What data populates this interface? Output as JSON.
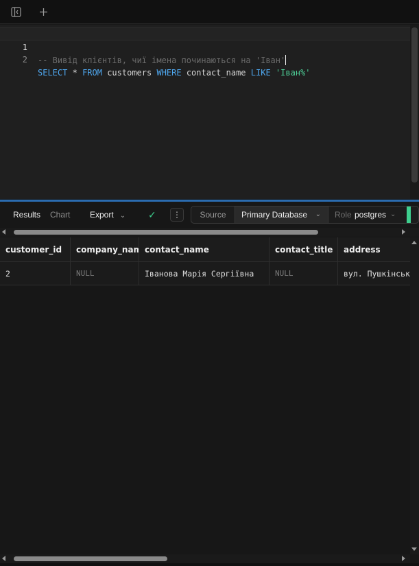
{
  "toolbar": {
    "icons": [
      "sidebar-toggle-icon",
      "plus-icon"
    ]
  },
  "editor": {
    "lines": [
      {
        "number": "1",
        "comment": "-- Вивід клієнтів, чиї імена починаються на 'Іван'"
      },
      {
        "number": "2",
        "tokens": {
          "select": "SELECT",
          "star": "*",
          "from": "FROM",
          "table": "customers",
          "where": "WHERE",
          "column": "contact_name",
          "like": "LIKE",
          "pattern": "'Іван%'"
        }
      }
    ]
  },
  "results_toolbar": {
    "tabs": [
      "Results",
      "Chart"
    ],
    "active_tab": "Results",
    "export_label": "Export",
    "source_label": "Source",
    "database": "Primary Database",
    "role_label": "Role",
    "role_value": "postgres"
  },
  "colors": {
    "accent_green": "#3ecf8e",
    "keyword_blue": "#4fa8f0",
    "string_green": "#4fd39a",
    "resize_handle": "#2b6cb0"
  },
  "grid": {
    "columns": [
      "customer_id",
      "company_name",
      "contact_name",
      "contact_title",
      "address"
    ],
    "rows": [
      [
        "2",
        "NULL",
        "Іванова Марія Сергіївна",
        "NULL",
        "вул. Пушкінська"
      ]
    ]
  }
}
